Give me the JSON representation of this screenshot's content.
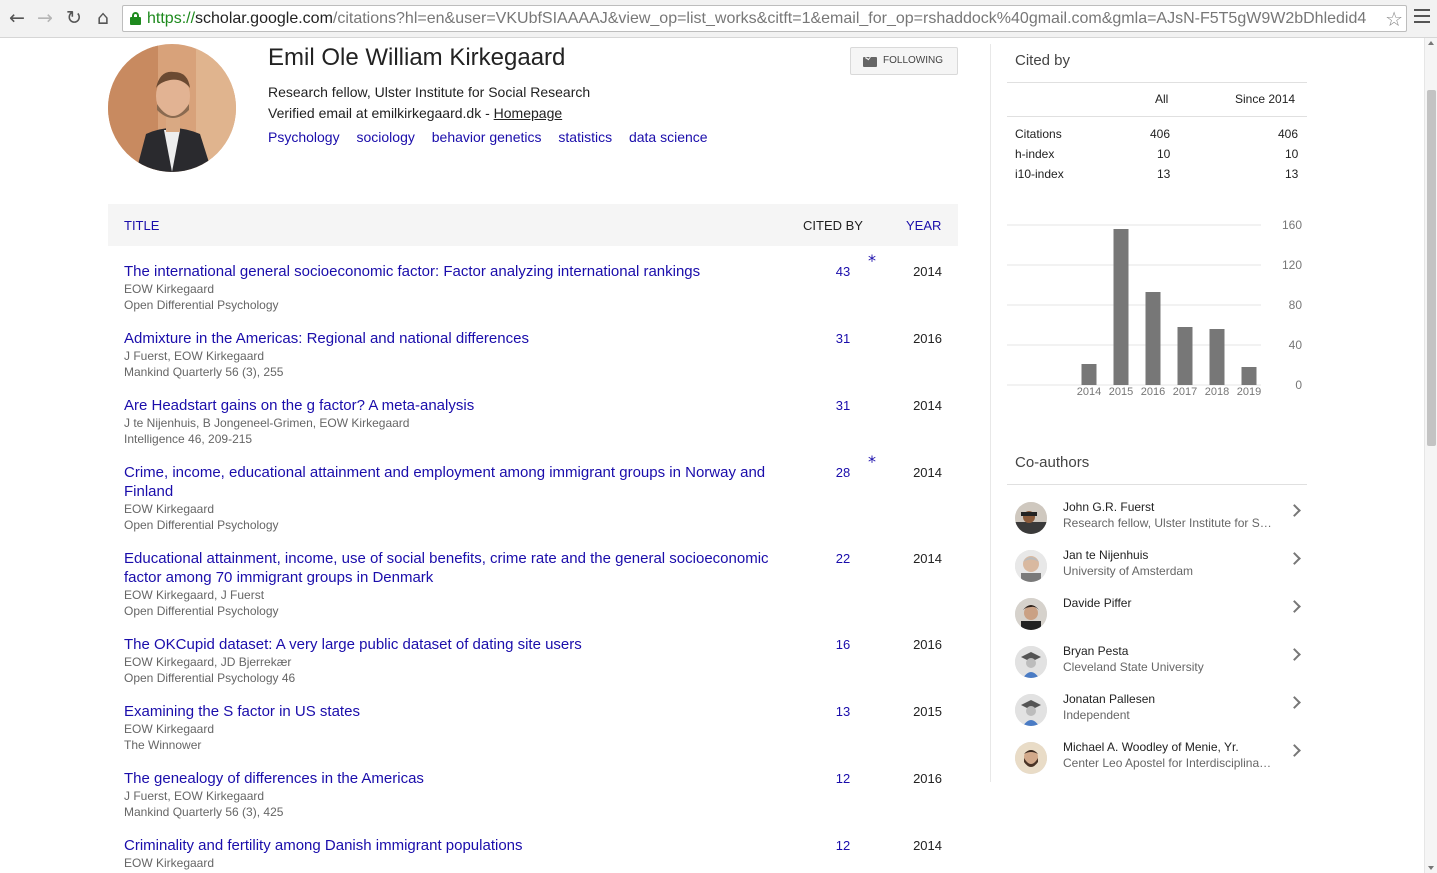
{
  "browser": {
    "url_scheme": "https://",
    "url_host": "scholar.google.com",
    "url_rest": "/citations?hl=en&user=VKUbfSIAAAAJ&view_op=list_works&citft=1&email_for_op=rshaddock%40gmail.com&gmla=AJsN-F5T5gW9W2bDhledid4"
  },
  "profile": {
    "name": "Emil Ole William Kirkegaard",
    "affiliation": "Research fellow, Ulster Institute for Social Research",
    "email_prefix": "Verified email at emilkirkegaard.dk - ",
    "homepage_label": "Homepage",
    "interests": [
      "Psychology",
      "sociology",
      "behavior genetics",
      "statistics",
      "data science"
    ],
    "follow_label": "FOLLOWING"
  },
  "table": {
    "col_title": "TITLE",
    "col_cited": "CITED BY",
    "col_year": "YEAR"
  },
  "articles": [
    {
      "title": "The international general socioeconomic factor: Factor analyzing international rankings",
      "authors": "EOW Kirkegaard",
      "venue": "Open Differential Psychology",
      "cited": "43",
      "star": "*",
      "year": "2014"
    },
    {
      "title": "Admixture in the Americas: Regional and national differences",
      "authors": "J Fuerst, EOW Kirkegaard",
      "venue": "Mankind Quarterly 56 (3), 255",
      "cited": "31",
      "star": "",
      "year": "2016"
    },
    {
      "title": "Are Headstart gains on the g factor? A meta-analysis",
      "authors": "J te Nijenhuis, B Jongeneel-Grimen, EOW Kirkegaard",
      "venue": "Intelligence 46, 209-215",
      "cited": "31",
      "star": "",
      "year": "2014"
    },
    {
      "title": "Crime, income, educational attainment and employment among immigrant groups in Norway and Finland",
      "authors": "EOW Kirkegaard",
      "venue": "Open Differential Psychology",
      "cited": "28",
      "star": "*",
      "year": "2014"
    },
    {
      "title": "Educational attainment, income, use of social benefits, crime rate and the general socioeconomic factor among 70 immigrant groups in Denmark",
      "authors": "EOW Kirkegaard, J Fuerst",
      "venue": "Open Differential Psychology",
      "cited": "22",
      "star": "",
      "year": "2014"
    },
    {
      "title": "The OKCupid dataset: A very large public dataset of dating site users",
      "authors": "EOW Kirkegaard, JD Bjerrekær",
      "venue": "Open Differential Psychology 46",
      "cited": "16",
      "star": "",
      "year": "2016"
    },
    {
      "title": "Examining the S factor in US states",
      "authors": "EOW Kirkegaard",
      "venue": "The Winnower",
      "cited": "13",
      "star": "",
      "year": "2015"
    },
    {
      "title": "The genealogy of differences in the Americas",
      "authors": "J Fuerst, EOW Kirkegaard",
      "venue": "Mankind Quarterly 56 (3), 425",
      "cited": "12",
      "star": "",
      "year": "2016"
    },
    {
      "title": "Criminality and fertility among Danish immigrant populations",
      "authors": "EOW Kirkegaard",
      "venue": "",
      "cited": "12",
      "star": "",
      "year": "2014"
    }
  ],
  "cited_by": {
    "title": "Cited by",
    "col_all": "All",
    "col_since": "Since 2014",
    "rows": [
      {
        "label": "Citations",
        "all": "406",
        "since": "406"
      },
      {
        "label": "h-index",
        "all": "10",
        "since": "10"
      },
      {
        "label": "i10-index",
        "all": "13",
        "since": "13"
      }
    ]
  },
  "chart_data": {
    "type": "bar",
    "categories": [
      "2014",
      "2015",
      "2016",
      "2017",
      "2018",
      "2019"
    ],
    "values": [
      21,
      156,
      93,
      58,
      56,
      18
    ],
    "yticks": [
      "160",
      "120",
      "80",
      "40",
      "0"
    ],
    "ylim": [
      0,
      160
    ],
    "grid": true,
    "bar_color": "#777777"
  },
  "coauthors": {
    "title": "Co-authors",
    "items": [
      {
        "name": "John G.R. Fuerst",
        "affiliation": "Research fellow, Ulster Institute for Social Research",
        "avatar": "photo"
      },
      {
        "name": "Jan te Nijenhuis",
        "affiliation": "University of Amsterdam",
        "avatar": "photo"
      },
      {
        "name": "Davide Piffer",
        "affiliation": "",
        "avatar": "photo"
      },
      {
        "name": "Bryan Pesta",
        "affiliation": "Cleveland State University",
        "avatar": "placeholder-graduate"
      },
      {
        "name": "Jonatan Pallesen",
        "affiliation": "Independent",
        "avatar": "placeholder-graduate"
      },
      {
        "name": "Michael A. Woodley of Menie, Yr.",
        "affiliation": "Center Leo Apostel for Interdisciplinary Studies",
        "avatar": "photo"
      }
    ]
  }
}
